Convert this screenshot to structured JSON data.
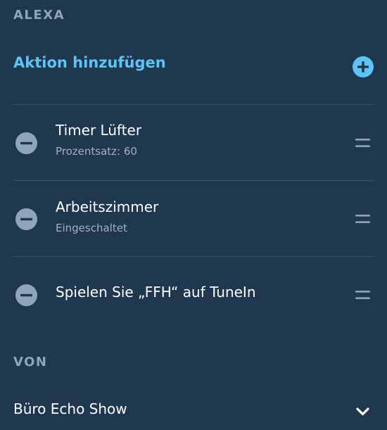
{
  "alexa_section": {
    "label": "ALEXA",
    "add_action_label": "Aktion hinzufügen",
    "actions": [
      {
        "title": "Timer Lüfter",
        "subtitle": "Prozentsatz: 60"
      },
      {
        "title": "Arbeitszimmer",
        "subtitle": "Eingeschaltet"
      },
      {
        "title": "Spielen Sie „FFH“ auf TuneIn"
      }
    ]
  },
  "from_section": {
    "label": "VON",
    "device": "Büro Echo Show"
  },
  "colors": {
    "background": "#1f374f",
    "accent": "#5ec4f5",
    "section_label": "#8fa6b8",
    "subtitle": "#9db1c2",
    "icon": "#8fa6b8",
    "divider": "#3c546b"
  },
  "icons": {
    "add": "plus-circle-icon",
    "remove": "minus-circle-icon",
    "reorder": "drag-handle-icon",
    "expand": "chevron-down-icon"
  }
}
